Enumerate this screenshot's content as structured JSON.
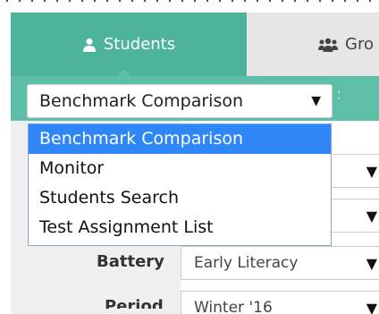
{
  "tabs": [
    {
      "label": "Students",
      "icon": "user-icon",
      "active": true
    },
    {
      "label": "Gro",
      "icon": "group-icon",
      "active": false
    }
  ],
  "report": {
    "selected": "Benchmark Comparison",
    "colon": ":",
    "options": [
      {
        "label": "Benchmark Comparison",
        "selected": true
      },
      {
        "label": "Monitor",
        "selected": false
      },
      {
        "label": "Students Search",
        "selected": false
      },
      {
        "label": "Test Assignment List",
        "selected": false
      }
    ]
  },
  "fields": {
    "battery": {
      "label": "Battery",
      "value": "Early Literacy"
    },
    "period": {
      "label": "Period",
      "value": "Winter '16"
    }
  },
  "colors": {
    "tab_active": "#4db39a",
    "bar": "#5dbfa7",
    "selection": "#2f86f6"
  }
}
